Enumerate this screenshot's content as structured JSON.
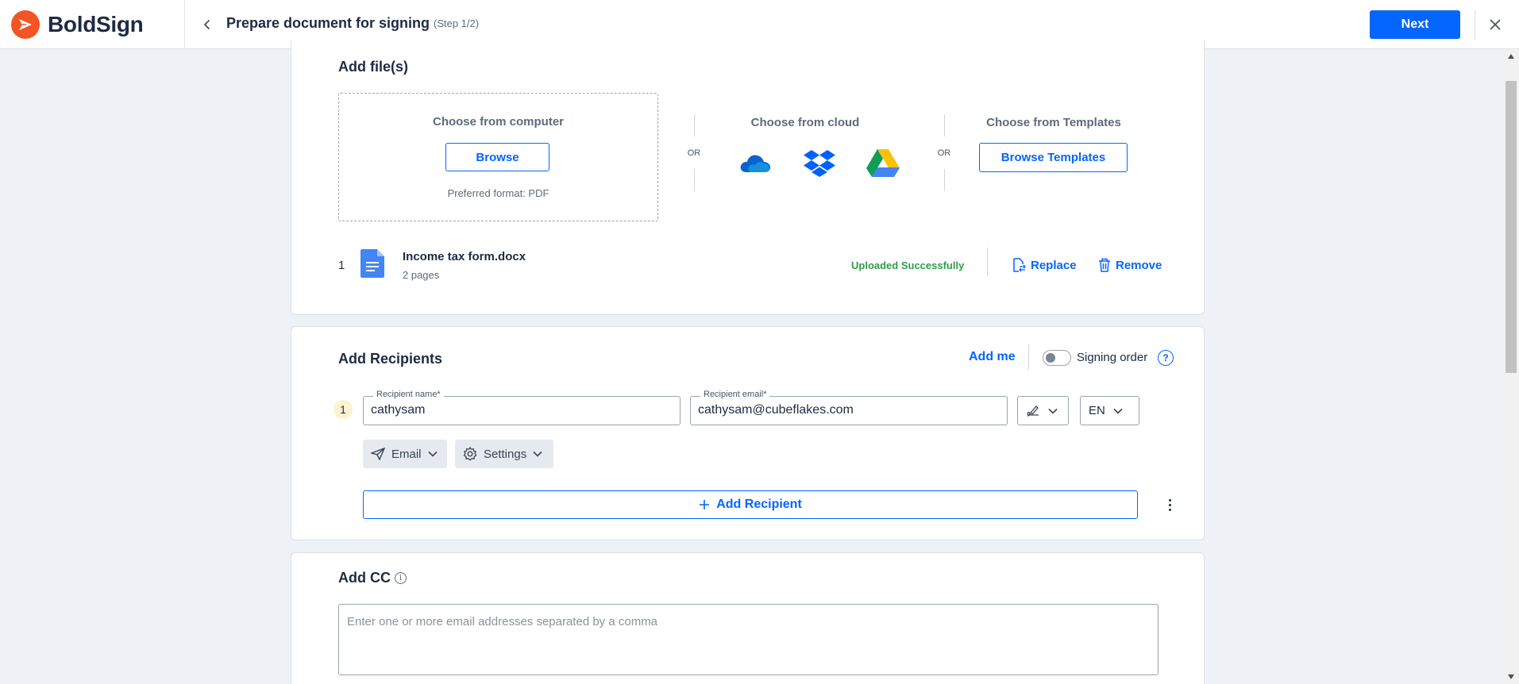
{
  "app": {
    "name": "BoldSign"
  },
  "header": {
    "title": "Prepare document for signing",
    "step": "(Step 1/2)",
    "next_label": "Next"
  },
  "files": {
    "title": "Add file(s)",
    "computer_label": "Choose from computer",
    "browse_label": "Browse",
    "format_hint": "Preferred format: PDF",
    "or_label": "OR",
    "cloud_label": "Choose from cloud",
    "cloud_sources": [
      "onedrive-icon",
      "dropbox-icon",
      "google-drive-icon"
    ],
    "templates_label": "Choose from Templates",
    "browse_templates_label": "Browse Templates",
    "uploaded": {
      "index": "1",
      "name": "Income tax form.docx",
      "pages": "2 pages",
      "status": "Uploaded Successfully",
      "replace_label": "Replace",
      "remove_label": "Remove"
    }
  },
  "recipients": {
    "title": "Add Recipients",
    "add_me_label": "Add me",
    "signing_order_label": "Signing order",
    "signing_order_enabled": false,
    "help_label": "?",
    "items": [
      {
        "index": "1",
        "name_label": "Recipient name*",
        "name_value": "cathysam",
        "email_label": "Recipient email*",
        "email_value": "cathysam@cubeflakes.com",
        "language": "EN",
        "delivery_label": "Email",
        "settings_label": "Settings"
      }
    ],
    "add_recipient_label": "Add Recipient"
  },
  "cc": {
    "title": "Add CC",
    "placeholder": "Enter one or more email addresses separated by a comma"
  },
  "colors": {
    "primary": "#0565ff",
    "brand": "#f25423",
    "success": "#2e9d4a",
    "background": "#eef1f6"
  }
}
